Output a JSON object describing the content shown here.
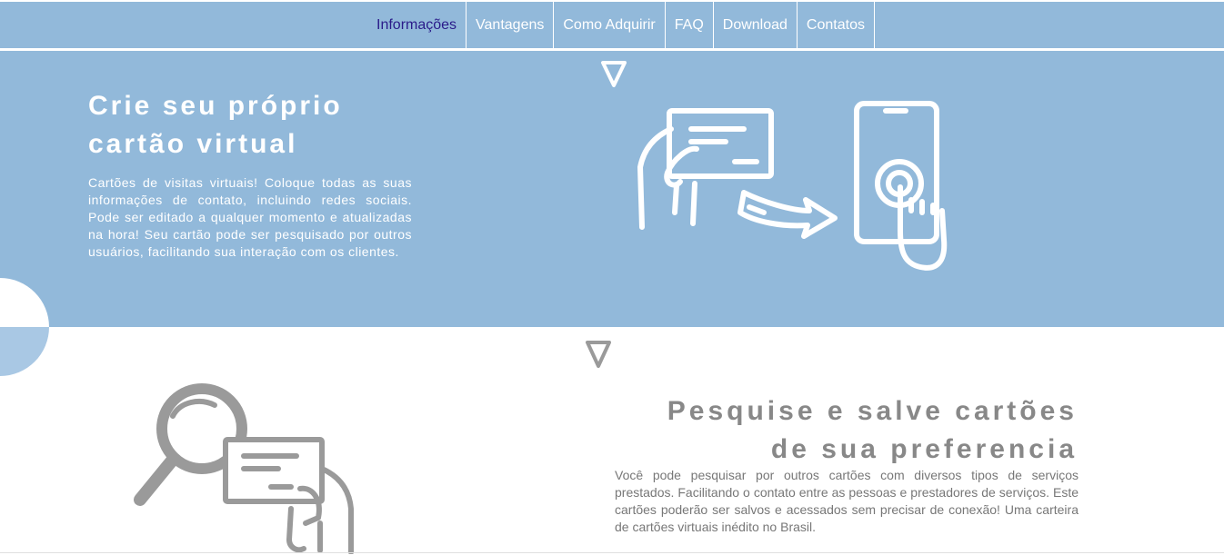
{
  "nav": {
    "items": [
      {
        "label": "Informações",
        "active": true
      },
      {
        "label": "Vantagens"
      },
      {
        "label": "Como Adquirir"
      },
      {
        "label": "FAQ"
      },
      {
        "label": "Download"
      },
      {
        "label": "Contatos"
      }
    ]
  },
  "hero": {
    "title_line1": "Crie seu próprio",
    "title_line2": "cartão virtual",
    "text": "Cartões de visitas virtuais! Coloque todas as suas informações de contato, incluindo redes sociais. Pode ser editado a qualquer momento e atualizadas na hora! Seu cartão pode ser pesquisado por outros usuários, facilitando sua interação com os clientes.",
    "illustration_icon": "hand-card-to-phone-icon"
  },
  "section2": {
    "title_line1": "Pesquise e salve cartões",
    "title_line2": "de sua preferencia",
    "text": "Você pode pesquisar por outros cartões com diversos tipos de serviços prestados. Facilitando o contato entre as pessoas e prestadores de serviços. Este cartões poderão ser salvos e acessados sem precisar de conexão! Uma carteira de cartões virtuais inédito no Brasil.",
    "illustration_icon": "magnifier-card-icon"
  },
  "colors": {
    "brand": "#92b9da",
    "active_nav": "#2a1b8a",
    "text_gray": "#888888"
  }
}
